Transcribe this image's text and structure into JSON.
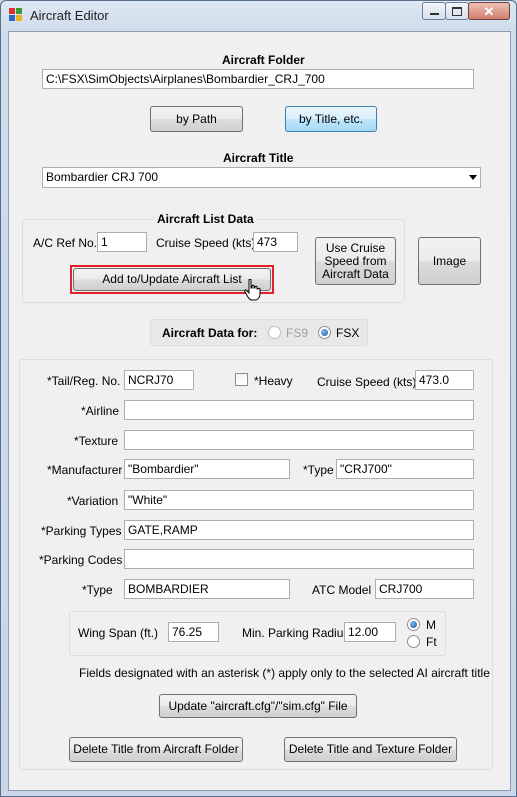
{
  "window": {
    "title": "Aircraft Editor"
  },
  "folder": {
    "heading": "Aircraft Folder",
    "path_value": "C:\\FSX\\SimObjects\\Airplanes\\Bombardier_CRJ_700",
    "by_path_label": "by Path",
    "by_title_label": "by Title, etc."
  },
  "title_section": {
    "heading": "Aircraft Title",
    "selected": "Bombardier CRJ 700"
  },
  "list_data": {
    "heading": "Aircraft List Data",
    "ref_label": "A/C Ref No.",
    "ref_value": "1",
    "cruise_label": "Cruise Speed (kts)",
    "cruise_value": "473",
    "add_button": "Add to/Update Aircraft List",
    "use_cruise_button": "Use Cruise Speed from Aircraft Data",
    "image_button": "Image"
  },
  "data_for": {
    "label": "Aircraft Data for:",
    "fs9_label": "FS9",
    "fsx_label": "FSX",
    "fsx_selected": true
  },
  "details": {
    "tail_label": "*Tail/Reg. No.",
    "tail_value": "NCRJ70",
    "heavy_label": "*Heavy",
    "heavy_checked": false,
    "cruise_label": "Cruise Speed (kts)",
    "cruise_value": "473.0",
    "airline_label": "*Airline",
    "airline_value": "",
    "texture_label": "*Texture",
    "texture_value": "",
    "manufacturer_label": "*Manufacturer",
    "manufacturer_value": "\"Bombardier\"",
    "type_label_1": "*Type",
    "type_value_1": "\"CRJ700\"",
    "variation_label": "*Variation",
    "variation_value": "\"White\"",
    "parking_types_label": "*Parking Types",
    "parking_types_value": "GATE,RAMP",
    "parking_codes_label": "*Parking Codes",
    "parking_codes_value": "",
    "type_label_2": "*Type",
    "type_value_2": "BOMBARDIER",
    "atc_model_label": "ATC Model",
    "atc_model_value": "CRJ700",
    "wingspan_label": "Wing Span (ft.)",
    "wingspan_value": "76.25",
    "min_radius_label": "Min. Parking Radius",
    "min_radius_value": "12.00",
    "unit_m_label": "M",
    "unit_ft_label": "Ft",
    "unit_selected": "M",
    "note": "Fields designated with an asterisk (*) apply only to the selected AI aircraft title",
    "update_button": "Update  \"aircraft.cfg\"/\"sim.cfg\"  File",
    "delete_title_button": "Delete Title from Aircraft Folder",
    "delete_title_texture_button": "Delete Title and Texture Folder"
  },
  "colors": {
    "focus_outline": "#e0202b",
    "hot_button_border": "#3c7fb1",
    "client_bg": "#f0f0f0"
  },
  "icons": [
    "app-icon",
    "minimize-icon",
    "maximize-icon",
    "close-icon",
    "dropdown-arrow-icon",
    "hand-cursor-icon"
  ]
}
